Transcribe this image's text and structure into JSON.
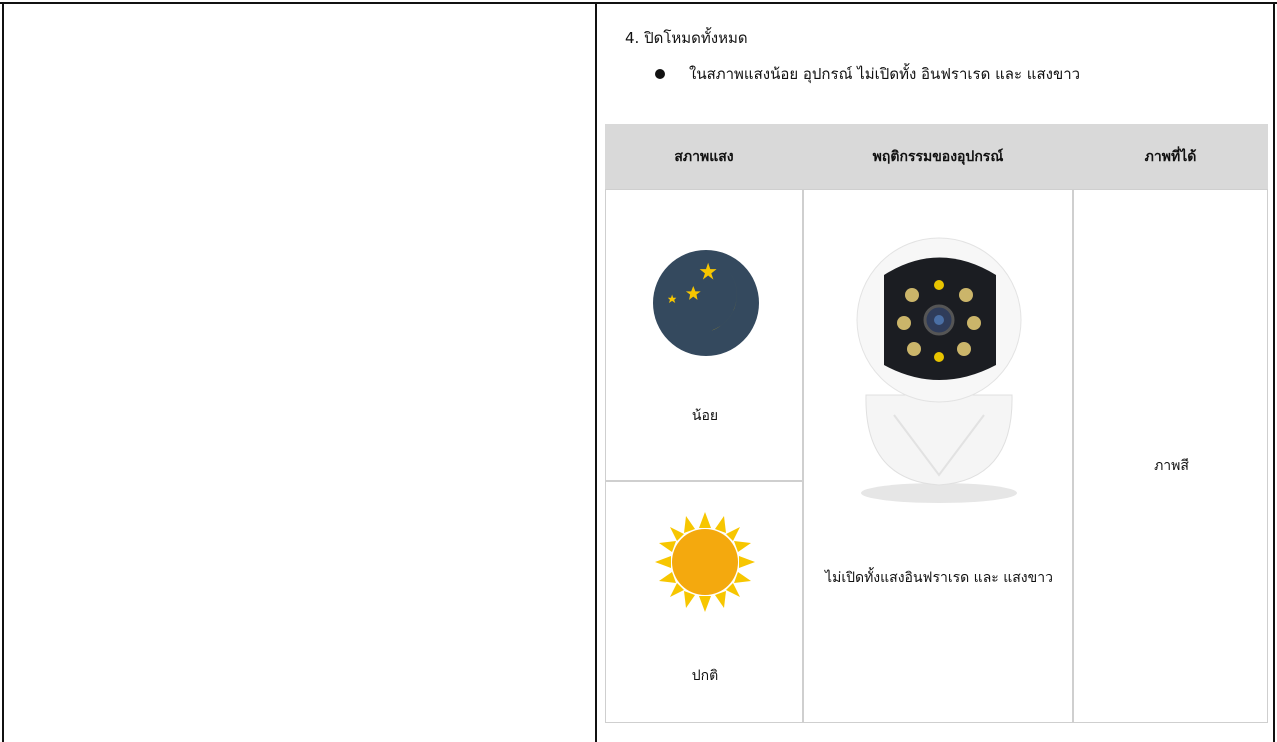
{
  "heading": "4. ปิดโหมดทั้งหมด",
  "bullet": "ในสภาพแสงน้อย อุปกรณ์ ไม่เปิดทั้ง อินฟราเรด และ แสงขาว",
  "table": {
    "headers": [
      "สภาพแสง",
      "พฤติกรรมของอุปกรณ์",
      "ภาพที่ได้"
    ],
    "light_conditions": [
      {
        "label": "น้อย",
        "icon": "moon-icon"
      },
      {
        "label": "ปกติ",
        "icon": "sun-icon"
      }
    ],
    "behavior": "ไม่เปิดทั้งแสงอินฟราเรด และ  แสงขาว",
    "result": "ภาพสี"
  },
  "colors": {
    "header_bg": "#d9d9d9",
    "moon_bg": "#34495e",
    "moon": "#f7c600",
    "sun": "#f4a90e"
  }
}
